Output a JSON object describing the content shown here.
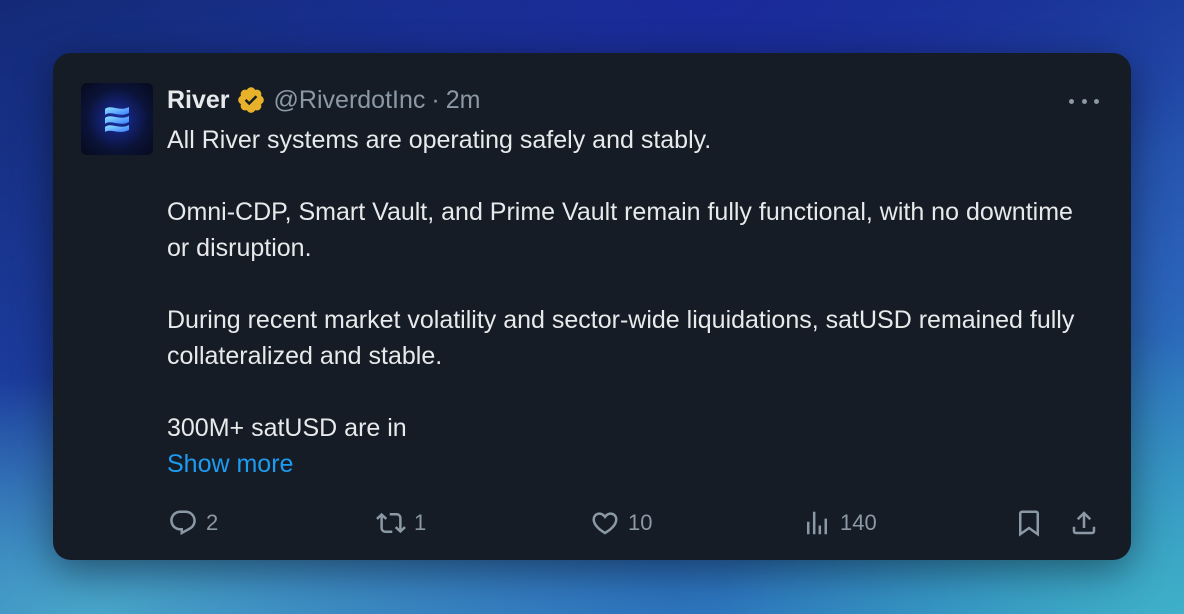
{
  "tweet": {
    "author": {
      "display_name": "River",
      "handle": "@RiverdotInc",
      "separator": "·",
      "time": "2m",
      "verified": true,
      "avatar_icon": "river-logo-icon"
    },
    "paragraphs": [
      "All River systems are operating safely and stably.",
      "Omni-CDP, Smart Vault, and Prime Vault remain fully functional, with no downtime or disruption.",
      "During recent market volatility and sector-wide liquidations, satUSD remained fully collateralized and stable.",
      "300M+ satUSD are in"
    ],
    "show_more": "Show more",
    "actions": {
      "replies": "2",
      "reposts": "1",
      "likes": "10",
      "views": "140"
    }
  },
  "colors": {
    "card_background": "#151c26",
    "text_primary": "#e7e9ea",
    "text_secondary": "#8b98a5",
    "link": "#1d9bf0",
    "verified_badge": "#e8b12a"
  }
}
